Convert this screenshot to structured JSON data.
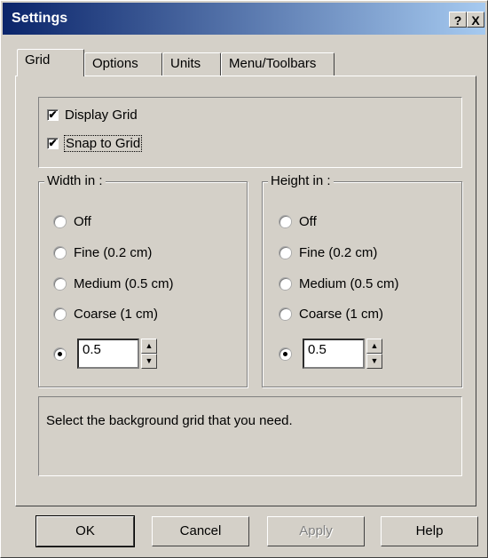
{
  "window": {
    "title": "Settings",
    "help_glyph": "?",
    "close_glyph": "X"
  },
  "tabs": [
    {
      "label": "Grid",
      "active": true
    },
    {
      "label": "Options",
      "active": false
    },
    {
      "label": "Units",
      "active": false
    },
    {
      "label": "Menu/Toolbars",
      "active": false
    }
  ],
  "grid": {
    "display_grid": {
      "label": "Display Grid",
      "checked": true
    },
    "snap_to_grid": {
      "label": "Snap to Grid",
      "checked": true
    }
  },
  "width_group": {
    "label": "Width in :",
    "options": [
      "Off",
      "Fine (0.2 cm)",
      "Medium (0.5 cm)",
      "Coarse (1 cm)"
    ],
    "custom_value": "0.5",
    "selected": "custom"
  },
  "height_group": {
    "label": "Height in :",
    "options": [
      "Off",
      "Fine (0.2 cm)",
      "Medium (0.5 cm)",
      "Coarse (1 cm)"
    ],
    "custom_value": "0.5",
    "selected": "custom"
  },
  "status_text": "Select the background grid that you need.",
  "buttons": {
    "ok": "OK",
    "cancel": "Cancel",
    "apply": "Apply",
    "help": "Help"
  },
  "check_glyph": "✔"
}
